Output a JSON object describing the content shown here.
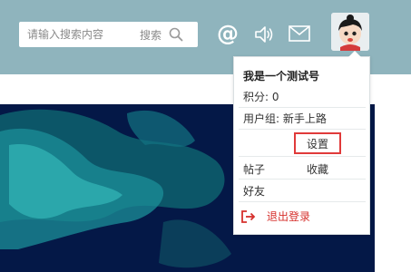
{
  "header": {
    "search": {
      "placeholder": "请输入搜索内容",
      "button_label": "搜索"
    },
    "icons": [
      "at-icon",
      "sound-icon",
      "mail-icon"
    ],
    "at_glyph": "@"
  },
  "user_menu": {
    "username": "我是一个测试号",
    "points": "积分: 0",
    "user_group": "用户组: 新手上路",
    "settings_label": "设置",
    "posts_label": "帖子",
    "favorites_label": "收藏",
    "friends_label": "好友",
    "logout_label": "退出登录"
  },
  "colors": {
    "header_bg": "#8fb4bd",
    "hero_bg": "#041847",
    "accent_red": "#d6302c",
    "highlight_border": "#e03a3a"
  }
}
